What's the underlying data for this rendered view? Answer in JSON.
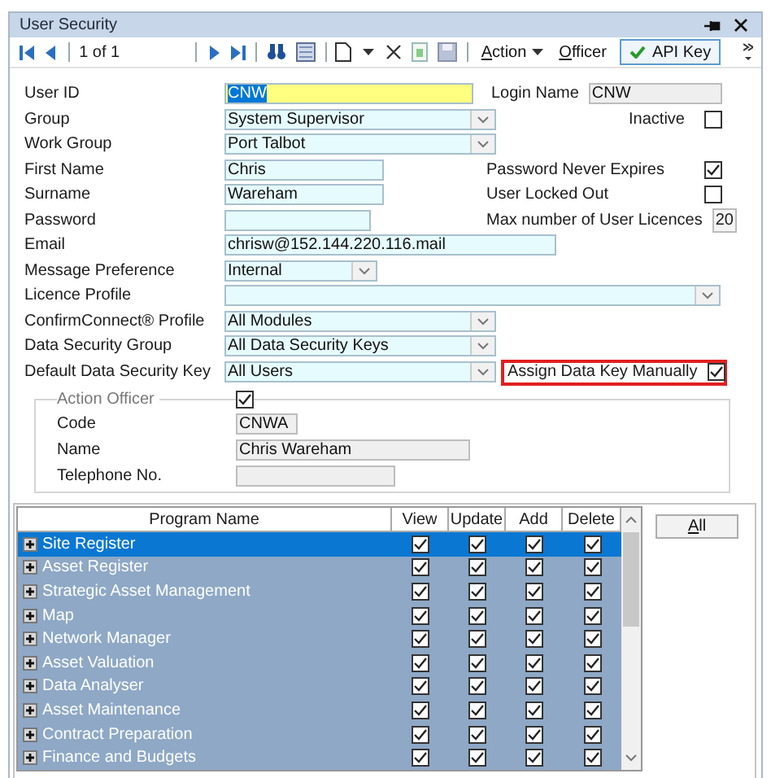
{
  "window": {
    "title": "User Security"
  },
  "toolbar": {
    "record": "1 of 1",
    "action_menu": "Action",
    "officer_button": "Officer",
    "api_key_button": {
      "label": "API Key",
      "pressed": true
    }
  },
  "form": {
    "rows": [
      {
        "label": "User ID",
        "field": {
          "kind": "text",
          "value": "CNW",
          "focused": true
        },
        "right": {
          "kind": "text",
          "label": "Login Name",
          "value": "CNW",
          "readonly": true
        }
      },
      {
        "label": "Group",
        "field": {
          "kind": "combo",
          "value": "System Supervisor"
        },
        "right": {
          "kind": "check",
          "label": "Inactive",
          "checked": false
        }
      },
      {
        "label": "Work Group",
        "field": {
          "kind": "combo",
          "value": "Port Talbot"
        }
      },
      {
        "label": "First Name",
        "field": {
          "kind": "text",
          "value": "Chris"
        },
        "right": {
          "kind": "check",
          "label": "Password Never Expires",
          "checked": true
        }
      },
      {
        "label": "Surname",
        "field": {
          "kind": "text",
          "value": "Wareham"
        },
        "right": {
          "kind": "check",
          "label": "User Locked Out",
          "checked": false
        }
      },
      {
        "label": "Password",
        "field": {
          "kind": "text"
        },
        "right": {
          "kind": "number",
          "label": "Max number of User Licences",
          "value": "20"
        }
      },
      {
        "label": "Email",
        "field": {
          "kind": "text",
          "value": "chrisw@152.144.220.116.mail"
        }
      },
      {
        "label": "Message Preference",
        "field": {
          "kind": "combo",
          "value": "Internal"
        }
      },
      {
        "label": "Licence Profile",
        "field": {
          "kind": "combo"
        }
      },
      {
        "label": "ConfirmConnect® Profile",
        "field": {
          "kind": "combo",
          "value": "All Modules"
        }
      },
      {
        "label": "Data Security Group",
        "field": {
          "kind": "combo",
          "value": "All Data Security Keys"
        }
      },
      {
        "label": "Default Data Security Key",
        "field": {
          "kind": "combo",
          "value": "All Users"
        },
        "right": {
          "kind": "check",
          "label": "Assign Data Key Manually",
          "checked": true,
          "highlighted": true
        }
      }
    ]
  },
  "action_officer": {
    "title": "Action Officer",
    "checked": true,
    "rows": [
      {
        "label": "Code",
        "value": "CNWA"
      },
      {
        "label": "Name",
        "value": "Chris Wareham"
      },
      {
        "label": "Telephone No."
      }
    ]
  },
  "permissions": {
    "columns": [
      "Program Name",
      "View",
      "Update",
      "Add",
      "Delete"
    ],
    "all_button": "All",
    "rows": [
      {
        "name": "Site Register",
        "selected": true,
        "view": true,
        "update": true,
        "add": true,
        "delete": true
      },
      {
        "name": "Asset Register",
        "selected": false,
        "view": true,
        "update": true,
        "add": true,
        "delete": true
      },
      {
        "name": "Strategic Asset Management",
        "selected": false,
        "view": true,
        "update": true,
        "add": true,
        "delete": true
      },
      {
        "name": "Map",
        "selected": false,
        "view": true,
        "update": true,
        "add": true,
        "delete": true
      },
      {
        "name": "Network Manager",
        "selected": false,
        "view": true,
        "update": true,
        "add": true,
        "delete": true
      },
      {
        "name": "Asset Valuation",
        "selected": false,
        "view": true,
        "update": true,
        "add": true,
        "delete": true
      },
      {
        "name": "Data Analyser",
        "selected": false,
        "view": true,
        "update": true,
        "add": true,
        "delete": true
      },
      {
        "name": "Asset Maintenance",
        "selected": false,
        "view": true,
        "update": true,
        "add": true,
        "delete": true
      },
      {
        "name": "Contract Preparation",
        "selected": false,
        "view": true,
        "update": true,
        "add": true,
        "delete": true
      },
      {
        "name": "Finance and Budgets",
        "selected": false,
        "view": true,
        "update": true,
        "add": true,
        "delete": true
      }
    ]
  }
}
